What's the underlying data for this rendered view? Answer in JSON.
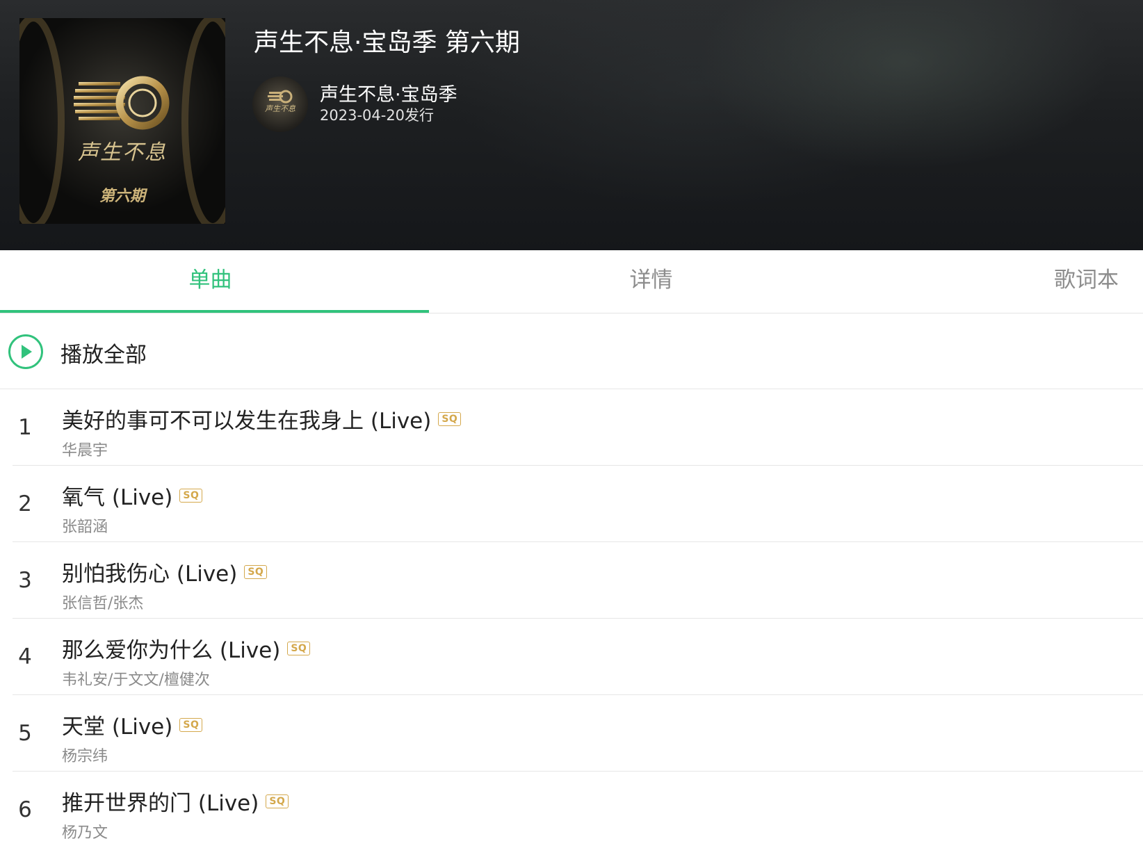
{
  "album": {
    "title": "声生不息·宝岛季 第六期",
    "artist": "声生不息·宝岛季",
    "release": "2023-04-20发行",
    "cover_title": "声生不息",
    "cover_episode": "第六期",
    "avatar_title": "声生不息"
  },
  "tabs": [
    {
      "label": "单曲",
      "active": true
    },
    {
      "label": "详情",
      "active": false
    },
    {
      "label": "歌词本",
      "active": false
    }
  ],
  "play_all": {
    "label": "播放全部"
  },
  "quality_badge": "SQ",
  "songs": [
    {
      "index": "1",
      "title": "美好的事可不可以发生在我身上 (Live)",
      "artist": "华晨宇"
    },
    {
      "index": "2",
      "title": "氧气 (Live)",
      "artist": "张韶涵"
    },
    {
      "index": "3",
      "title": "别怕我伤心 (Live)",
      "artist": "张信哲/张杰"
    },
    {
      "index": "4",
      "title": "那么爱你为什么 (Live)",
      "artist": "韦礼安/于文文/檀健次"
    },
    {
      "index": "5",
      "title": "天堂 (Live)",
      "artist": "杨宗纬"
    },
    {
      "index": "6",
      "title": "推开世界的门 (Live)",
      "artist": "杨乃文"
    }
  ],
  "colors": {
    "accent": "#31c27c",
    "sq_badge": "#d4a84c"
  }
}
